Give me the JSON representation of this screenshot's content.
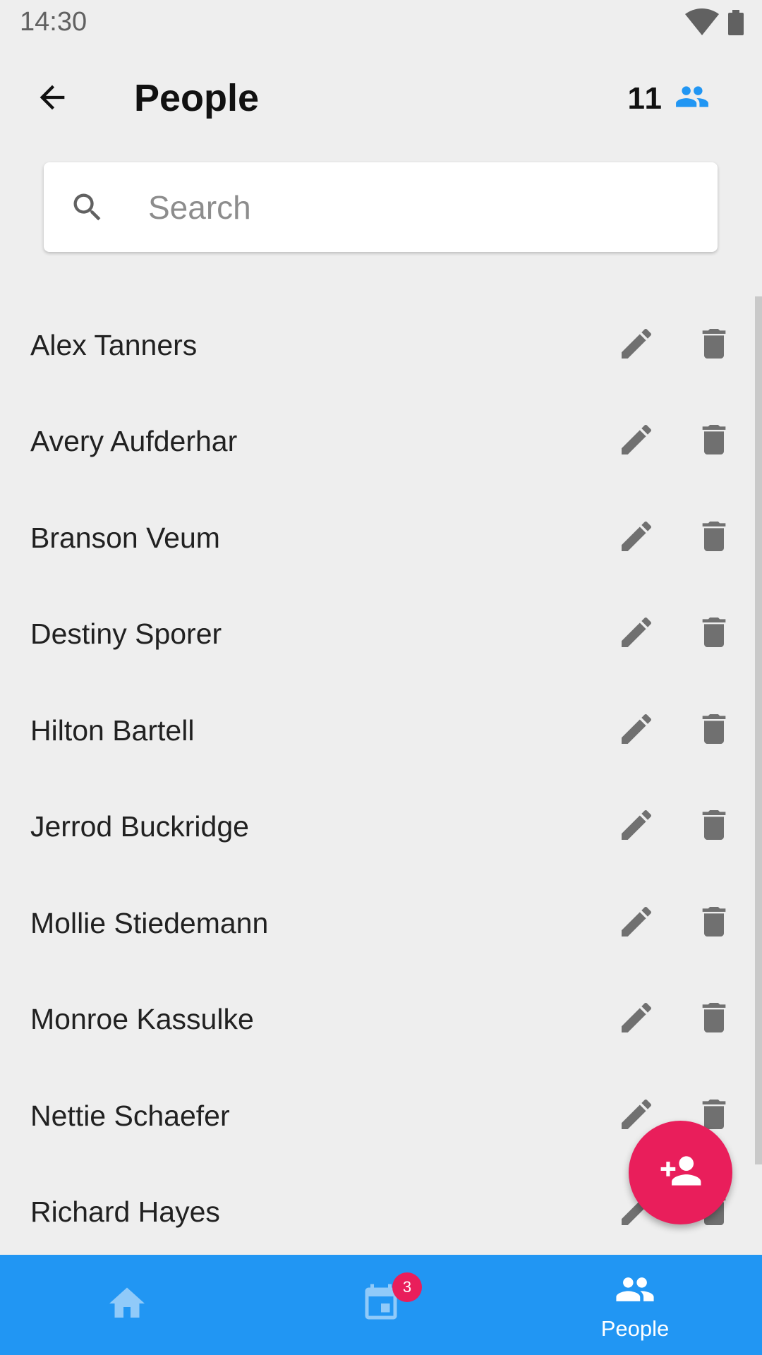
{
  "status_bar": {
    "time": "14:30",
    "icons": [
      "wifi-icon",
      "battery-icon"
    ]
  },
  "header": {
    "back_icon": "arrow-back-icon",
    "title": "People",
    "count": "11",
    "count_icon": "people-icon"
  },
  "search": {
    "icon": "search-icon",
    "placeholder": "Search",
    "value": ""
  },
  "people": [
    {
      "name": "Alex Tanners"
    },
    {
      "name": "Avery Aufderhar"
    },
    {
      "name": "Branson Veum"
    },
    {
      "name": "Destiny Sporer"
    },
    {
      "name": "Hilton Bartell"
    },
    {
      "name": "Jerrod Buckridge"
    },
    {
      "name": "Mollie Stiedemann"
    },
    {
      "name": "Monroe Kassulke"
    },
    {
      "name": "Nettie Schaefer"
    },
    {
      "name": "Richard Hayes"
    }
  ],
  "row_actions": {
    "edit_icon": "pencil-icon",
    "delete_icon": "trash-icon"
  },
  "fab": {
    "icon": "add-person-icon"
  },
  "bottom_nav": {
    "items": [
      {
        "icon": "home-icon",
        "label": ""
      },
      {
        "icon": "calendar-icon",
        "label": "",
        "badge": "3"
      },
      {
        "icon": "people-icon",
        "label": "People",
        "active": true
      }
    ]
  },
  "colors": {
    "background": "#eeeeee",
    "accent": "#2196f3",
    "fab": "#e91e5b",
    "icon_gray": "#707070"
  }
}
